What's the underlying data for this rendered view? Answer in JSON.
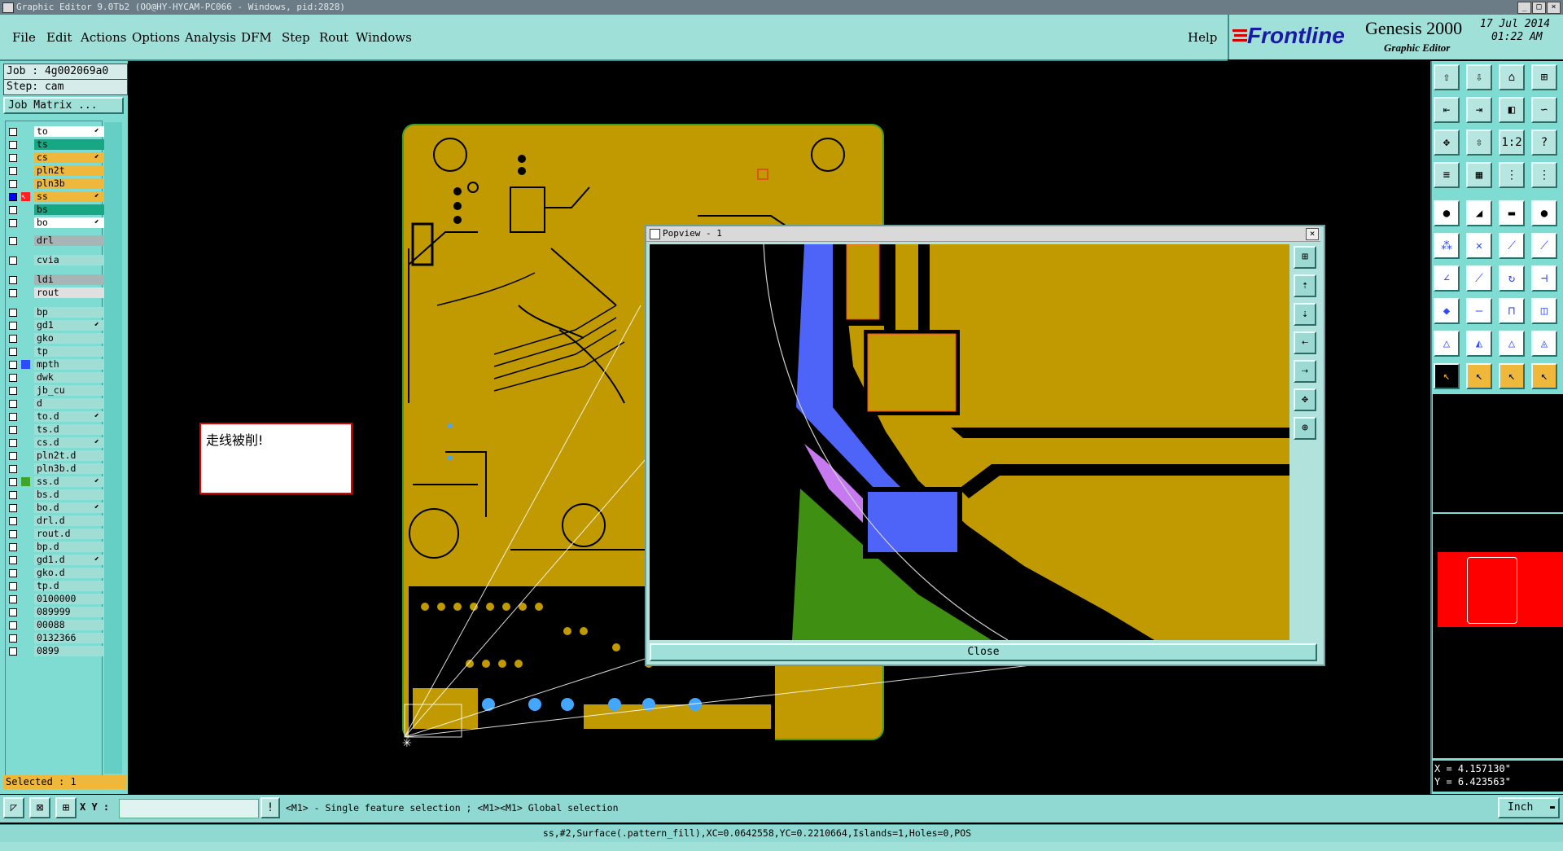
{
  "window": {
    "title": "Graphic Editor 9.0Tb2 (OO@HY-HYCAM-PC066 - Windows, pid:2828)"
  },
  "menubar": {
    "items": [
      "File",
      "Edit",
      "Actions",
      "Options",
      "Analysis",
      "DFM",
      "Step",
      "Rout",
      "Windows"
    ],
    "help": "Help"
  },
  "brand": {
    "logo": "Frontline",
    "product": "Genesis 2000",
    "subtitle": "Graphic Editor",
    "date": "17 Jul 2014",
    "time": "01:22 AM"
  },
  "job": {
    "job_label": "Job : 4g002069a0",
    "step_label": "Step: cam",
    "matrix_button": "Job Matrix ..."
  },
  "layers": [
    {
      "name": "to",
      "color": "#ffffff",
      "edit": true
    },
    {
      "name": "ts",
      "color": "#17a883",
      "edit": false
    },
    {
      "name": "cs",
      "color": "#f0b83a",
      "edit": true
    },
    {
      "name": "pln2t",
      "color": "#f0b83a",
      "edit": false
    },
    {
      "name": "pln3b",
      "color": "#f0b83a",
      "edit": false
    },
    {
      "name": "ss",
      "color": "#f0b83a",
      "edit": true,
      "active": true
    },
    {
      "name": "bs",
      "color": "#17a883",
      "edit": false
    },
    {
      "name": "bo",
      "color": "#ffffff",
      "edit": true
    },
    {
      "name": "drl",
      "color": "#a8b5b5",
      "edit": false
    },
    {
      "name": "cvia",
      "color": "#a0ddd5",
      "edit": false
    },
    {
      "name": "ldi",
      "color": "#a8b5b5",
      "edit": false
    },
    {
      "name": "rout",
      "color": "#e0e0e0",
      "edit": false
    },
    {
      "name": "bp",
      "color": "#a0ddd5",
      "edit": false
    },
    {
      "name": "gd1",
      "color": "#a0ddd5",
      "edit": true
    },
    {
      "name": "gko",
      "color": "#a0ddd5",
      "edit": false
    },
    {
      "name": "tp",
      "color": "#a0ddd5",
      "edit": false
    },
    {
      "name": "mpth",
      "color": "#a0ddd5",
      "edit": false,
      "mark": "#2b4cff"
    },
    {
      "name": "dwk",
      "color": "#a0ddd5",
      "edit": false
    },
    {
      "name": "jb_cu",
      "color": "#a0ddd5",
      "edit": false
    },
    {
      "name": "d",
      "color": "#a0ddd5",
      "edit": false
    },
    {
      "name": "to.d",
      "color": "#a0ddd5",
      "edit": true
    },
    {
      "name": "ts.d",
      "color": "#a0ddd5",
      "edit": false
    },
    {
      "name": "cs.d",
      "color": "#a0ddd5",
      "edit": true
    },
    {
      "name": "pln2t.d",
      "color": "#a0ddd5",
      "edit": false
    },
    {
      "name": "pln3b.d",
      "color": "#a0ddd5",
      "edit": false
    },
    {
      "name": "ss.d",
      "color": "#a0ddd5",
      "edit": true,
      "mark": "#3fa52a"
    },
    {
      "name": "bs.d",
      "color": "#a0ddd5",
      "edit": false
    },
    {
      "name": "bo.d",
      "color": "#a0ddd5",
      "edit": true
    },
    {
      "name": "drl.d",
      "color": "#a0ddd5",
      "edit": false
    },
    {
      "name": "rout.d",
      "color": "#a0ddd5",
      "edit": false
    },
    {
      "name": "bp.d",
      "color": "#a0ddd5",
      "edit": false
    },
    {
      "name": "gd1.d",
      "color": "#a0ddd5",
      "edit": true
    },
    {
      "name": "gko.d",
      "color": "#a0ddd5",
      "edit": false
    },
    {
      "name": "tp.d",
      "color": "#a0ddd5",
      "edit": false
    },
    {
      "name": "0100000",
      "color": "#a0ddd5",
      "edit": false
    },
    {
      "name": "089999",
      "color": "#a0ddd5",
      "edit": false
    },
    {
      "name": "00088",
      "color": "#a0ddd5",
      "edit": false
    },
    {
      "name": "0132366",
      "color": "#a0ddd5",
      "edit": false
    },
    {
      "name": "0899",
      "color": "#a0ddd5",
      "edit": false
    }
  ],
  "selected": "Selected : 1",
  "annotation": "走线被削!",
  "popview": {
    "title": "Popview - 1",
    "close_label": "Close"
  },
  "coords": {
    "x": "X = 4.157130\"",
    "y": "Y = 6.423563\""
  },
  "status": {
    "xy_label": "X Y :",
    "xy_value": "",
    "hint": "<M1> - Single feature selection ; <M1><M1> Global selection",
    "units": "Inch"
  },
  "feature_info": "ss,#2,Surface(.pattern_fill),XC=0.0642558,YC=0.2210664,Islands=1,Holes=0,POS",
  "colors": {
    "board": "#c09a00",
    "teal_bg": "#9fe0d9",
    "blue_feature": "#4e63f7",
    "green_feature": "#3f8f12",
    "purple_feature": "#c77af0",
    "red_preview": "#ff0000"
  }
}
